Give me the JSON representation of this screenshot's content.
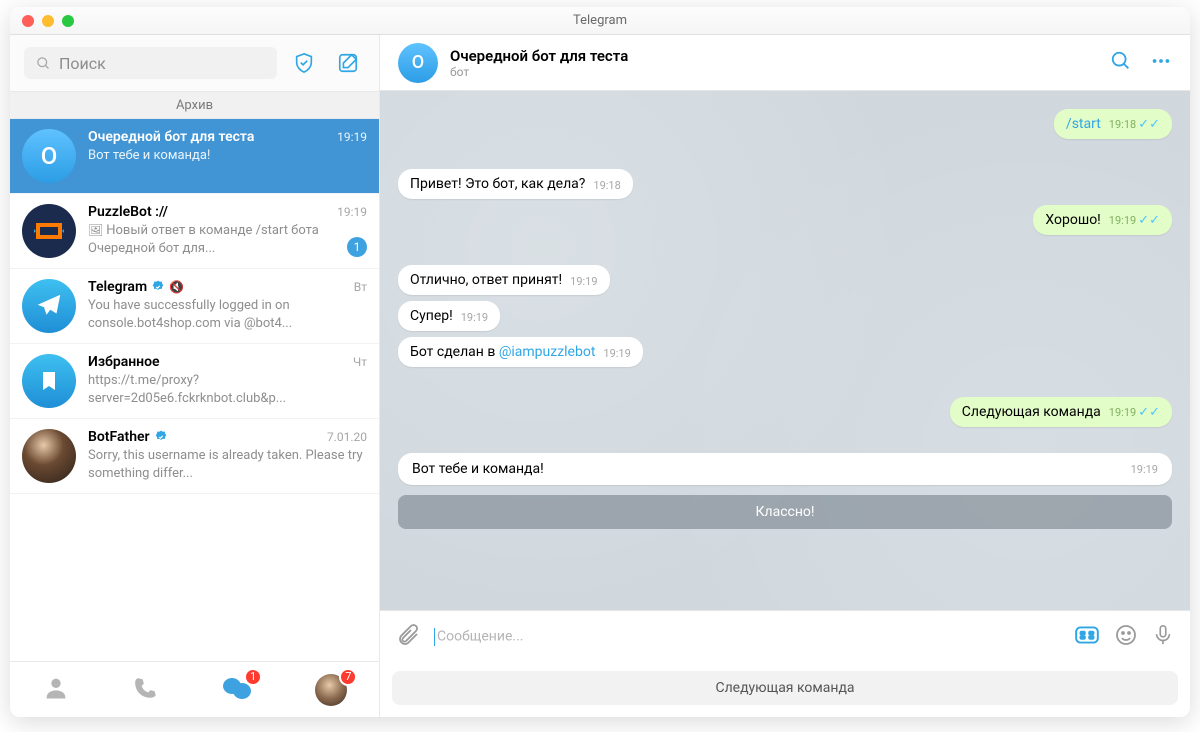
{
  "window_title": "Telegram",
  "search": {
    "placeholder": "Поиск"
  },
  "archive_label": "Архив",
  "chats": [
    {
      "name": "Очередной бот для теста",
      "preview": "Вот тебе и команда!",
      "time": "19:19",
      "avatar_letter": "О",
      "avatar_bg": "linear-gradient(#5fc2ff,#2c9de5)",
      "selected": true
    },
    {
      "name": "PuzzleBot ://",
      "preview_prefix": "🖼",
      "preview": "Новый ответ в команде /start бота Очередной бот для...",
      "time": "19:19",
      "badge": "1",
      "avatar_bg": "#1b2b4d"
    },
    {
      "name": "Telegram",
      "verified": true,
      "muted": true,
      "preview": "You have successfully logged in on console.bot4shop.com via @bot4...",
      "time": "Вт",
      "avatar_bg": "linear-gradient(#3ec0f0,#1f8ed6)"
    },
    {
      "name": "Избранное",
      "preview": "https://t.me/proxy?server=2d05e6.fckrknbot.club&p...",
      "time": "Чт",
      "avatar_bg": "linear-gradient(#3ec0f0,#1f8ed6)"
    },
    {
      "name": "BotFather",
      "verified": true,
      "preview": "Sorry, this username is already taken. Please try something differ...",
      "time": "7.01.20",
      "avatar_img": true
    }
  ],
  "tabs": {
    "chats_badge": "1",
    "last_badge": "7"
  },
  "header": {
    "avatar_letter": "О",
    "name": "Очередной бот для теста",
    "sub": "бот"
  },
  "messages": [
    {
      "dir": "out",
      "text": "/start",
      "time": "19:18",
      "ticks": true,
      "command": true
    },
    {
      "dir": "in",
      "text": "Привет! Это бот, как дела?",
      "time": "19:18"
    },
    {
      "dir": "out",
      "text": "Хорошо!",
      "time": "19:19",
      "ticks": true
    },
    {
      "dir": "in",
      "text": "Отлично, ответ принят!",
      "time": "19:19"
    },
    {
      "dir": "in",
      "text": "Супер!",
      "time": "19:19"
    },
    {
      "dir": "in",
      "text_before": "Бот сделан в ",
      "link": "@iampuzzlebot",
      "time": "19:19"
    },
    {
      "dir": "out",
      "text": "Следующая команда",
      "time": "19:19",
      "ticks": true
    },
    {
      "dir": "in_wide",
      "text": "Вот тебе и команда!",
      "time": "19:19",
      "buttons": [
        "Классно!"
      ]
    }
  ],
  "input": {
    "placeholder": "Сообщение..."
  },
  "reply_keyboard": [
    "Следующая команда"
  ]
}
